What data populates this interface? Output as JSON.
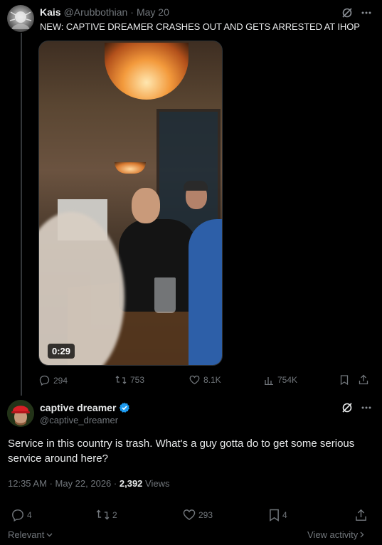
{
  "parent_tweet": {
    "display_name": "Kais",
    "handle": "@Arubbothian",
    "separator": "·",
    "date": "May 20",
    "text": "NEW: CAPTIVE DREAMER CRASHES OUT AND GETS ARRESTED AT IHOP",
    "video_duration": "0:29",
    "replies": "294",
    "reposts": "753",
    "likes": "8.1K",
    "views": "754K"
  },
  "main_tweet": {
    "display_name": "captive dreamer",
    "handle": "@captive_dreamer",
    "verified": true,
    "text": "Service in this country is trash.  What's a guy gotta do to get some serious service around here?",
    "time": "12:35 AM",
    "date": "May 22, 2026",
    "views_count": "2,392",
    "views_label": "Views",
    "replies": "4",
    "reposts": "2",
    "likes": "293",
    "bookmarks": "4"
  },
  "footer": {
    "sort_label": "Relevant",
    "view_activity": "View activity"
  },
  "colors": {
    "background": "#000000",
    "text": "#e7e9ea",
    "muted": "#71767b",
    "verified": "#1d9bf0",
    "divider": "#2f3336"
  },
  "icons": [
    "grok-icon",
    "more-icon",
    "reply-icon",
    "repost-icon",
    "like-icon",
    "views-icon",
    "bookmark-icon",
    "share-icon",
    "verified-badge-icon",
    "chevron-down-icon",
    "chevron-right-icon"
  ]
}
